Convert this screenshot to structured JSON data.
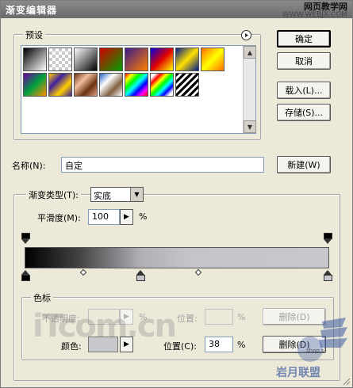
{
  "window": {
    "title": "渐变编辑器",
    "watermark_text": "网页教学网",
    "watermark_url": "WWW.WEBJX.COM"
  },
  "presets": {
    "label": "预设",
    "menu_icon": "circle-arrow-right-icon",
    "swatches_row1": [
      "black-white",
      "transparent-black",
      "black-white-2",
      "red-green",
      "violet-orange",
      "blue-red-yellow",
      "blue-yellow-blue",
      "orange-yellow-orange"
    ],
    "swatches_row2": [
      "violet-green-orange",
      "yellow-violet",
      "copper",
      "chrome",
      "spectrum",
      "rainbow-transparent",
      "stripes"
    ]
  },
  "buttons": {
    "ok": "确定",
    "cancel": "取消",
    "load": "载入(L)...",
    "save": "存储(S)...",
    "new": "新建(W)",
    "delete_opacity": "删除(D)",
    "delete_color": "删除(D)"
  },
  "name": {
    "label": "名称(N):",
    "value": "自定"
  },
  "gradient_type": {
    "label": "渐变类型(T):",
    "value": "实底",
    "smoothness_label": "平滑度(M):",
    "smoothness_value": "100",
    "smoothness_unit": "%"
  },
  "stops": {
    "group_label": "色标",
    "opacity_label": "不透明度:",
    "opacity_value": "",
    "opacity_unit": "%",
    "opacity_location_label": "位置:",
    "opacity_location_value": "",
    "opacity_location_unit": "%",
    "color_label": "颜色:",
    "color_location_label": "位置(C):",
    "color_location_value": "38",
    "color_location_unit": "%"
  },
  "watermark": {
    "left_text": "iTcom.cn",
    "logo_text": "shop.s",
    "logo_caption": "岩月联盟"
  },
  "colors": {
    "window_bg": "#ece9d8",
    "titlebar": "#7a7a7a",
    "gradient_stop_color": "#c8c8cc"
  }
}
